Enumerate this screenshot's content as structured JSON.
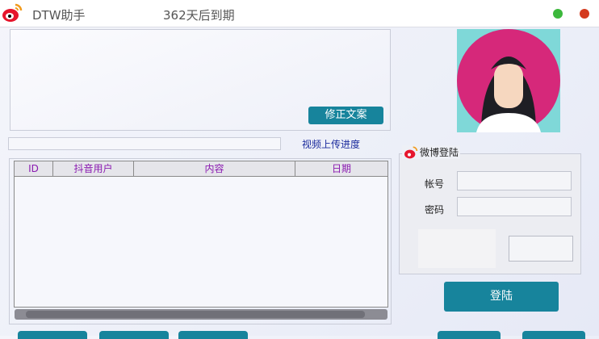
{
  "window": {
    "title": "DTW助手",
    "expiry": "362天后到期",
    "colors": {
      "accent": "#17849c",
      "minimize": "#3cb83c",
      "close": "#d43a1e"
    }
  },
  "editor": {
    "fix_button": "修正文案"
  },
  "upload": {
    "progress_label": "视频上传进度",
    "progress": 0
  },
  "table": {
    "columns": [
      "ID",
      "抖音用户",
      "内容",
      "日期"
    ],
    "rows": []
  },
  "login": {
    "title": "微博登陆",
    "account_label": "帐号",
    "password_label": "密码",
    "account_value": "",
    "password_value": "",
    "login_button": "登陆"
  }
}
